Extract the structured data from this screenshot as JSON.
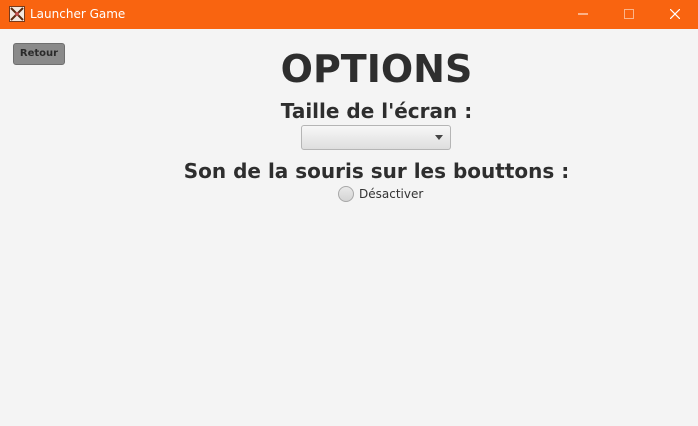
{
  "window": {
    "title": "Launcher Game",
    "accent_color": "#f96410",
    "controls": [
      "minimize-icon",
      "maximize-icon",
      "close-icon"
    ]
  },
  "toolbar": {
    "back_label": "Retour"
  },
  "main": {
    "title": "OPTIONS",
    "screen_size": {
      "label": "Taille de l'écran :",
      "selected_value": ""
    },
    "mouse_sound": {
      "label": "Son de la souris sur les bouttons :",
      "option_label": "Désactiver",
      "checked": false
    }
  }
}
